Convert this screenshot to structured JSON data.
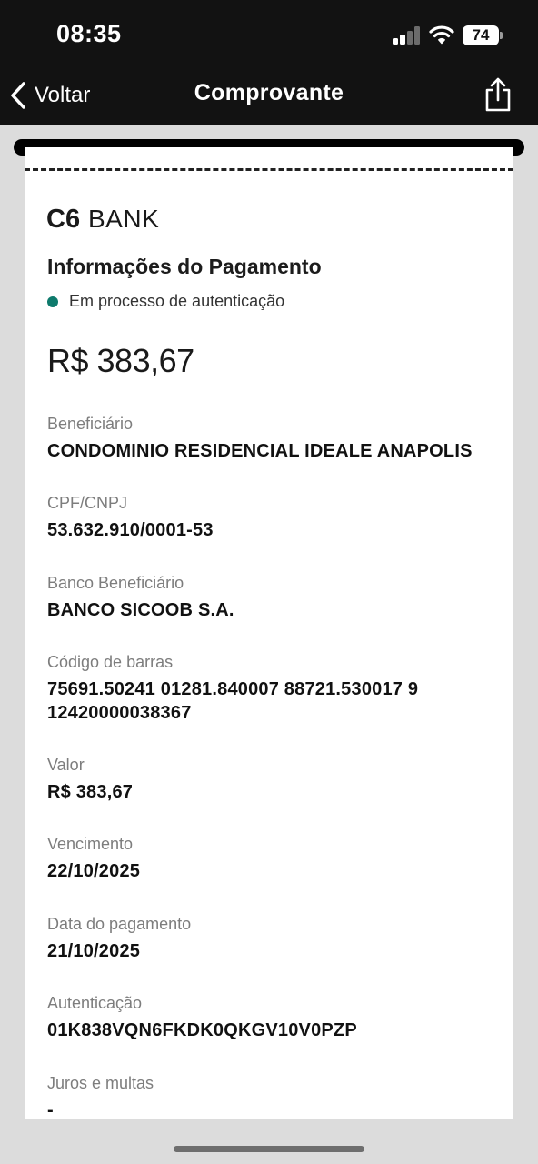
{
  "status_bar": {
    "time": "08:35",
    "battery": "74"
  },
  "nav": {
    "back_label": "Voltar",
    "title": "Comprovante"
  },
  "receipt": {
    "bank_logo": {
      "mark": "C6",
      "word": "BANK"
    },
    "section_title": "Informações do Pagamento",
    "status_text": "Em processo de autenticação",
    "status_color": "#0e7a6c",
    "amount": "R$ 383,67",
    "fields": [
      {
        "label": "Beneficiário",
        "value": "CONDOMINIO RESIDENCIAL IDEALE ANAPOLIS"
      },
      {
        "label": "CPF/CNPJ",
        "value": "53.632.910/0001-53"
      },
      {
        "label": "Banco Beneficiário",
        "value": "BANCO SICOOB S.A."
      },
      {
        "label": "Código de barras",
        "value_line1": "75691.50241 01281.840007 88721.530017 9",
        "value_line2": "12420000038367"
      },
      {
        "label": "Valor",
        "value": "R$ 383,67"
      },
      {
        "label": "Vencimento",
        "value": "22/10/2025"
      },
      {
        "label": "Data do pagamento",
        "value": "21/10/2025"
      },
      {
        "label": "Autenticação",
        "value": "01K838VQN6FKDK0QKGV10V0PZP"
      },
      {
        "label": "Juros e multas",
        "value": "-"
      }
    ]
  },
  "icons": {
    "back": "chevron-left-icon",
    "share": "share-icon",
    "wifi": "wifi-icon",
    "signal": "cell-signal-icon"
  }
}
